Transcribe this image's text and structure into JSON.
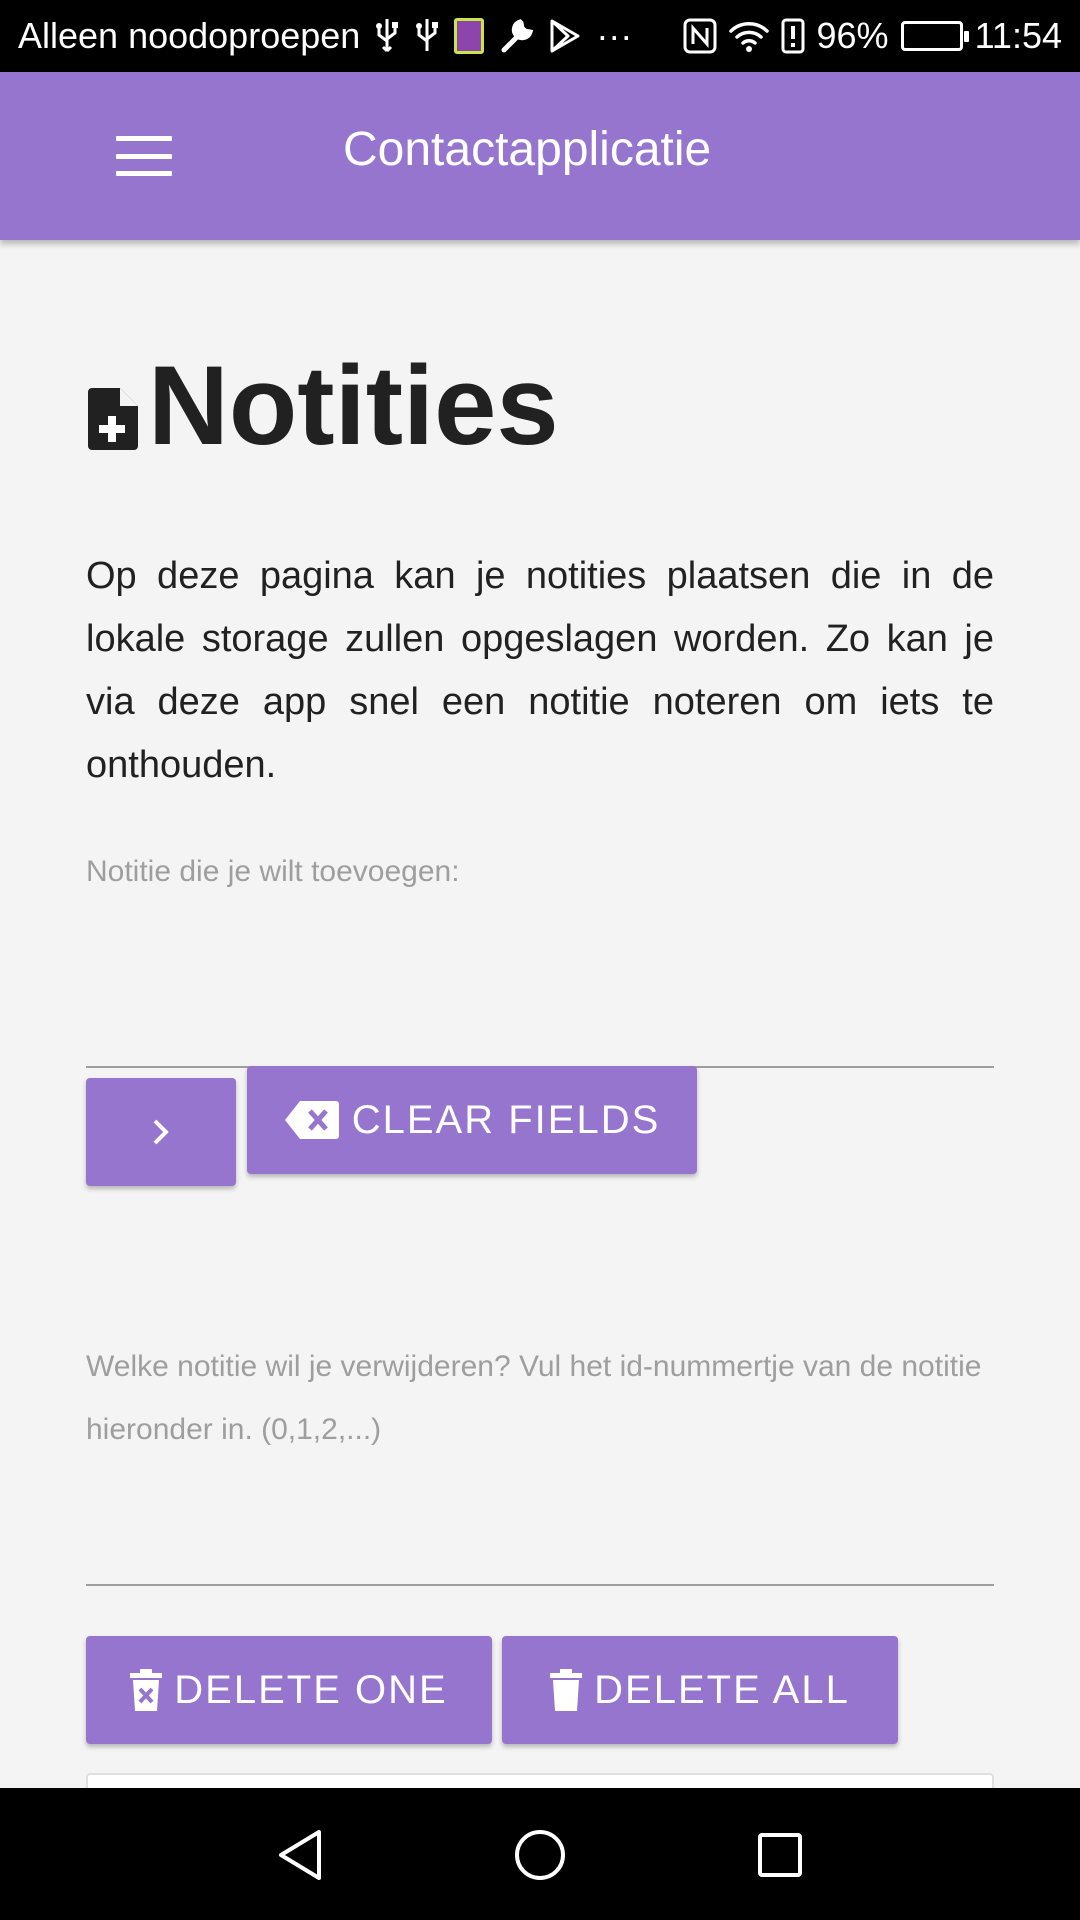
{
  "status_bar": {
    "carrier_text": "Alleen noodoproepen",
    "overflow": "···",
    "battery_percent": "96%",
    "time": "11:54",
    "icons": [
      "usb-icon",
      "usb-icon",
      "sim-card-icon",
      "wrench-icon",
      "play-store-icon",
      "nfc-icon",
      "wifi-icon",
      "alert-icon",
      "battery-icon"
    ]
  },
  "app_bar": {
    "title": "Contactapplicatie",
    "menu_icon": "menu-icon"
  },
  "page": {
    "title": "Notities",
    "title_icon": "note-add-icon",
    "intro": "Op deze pagina kan je notities plaatsen die in de lokale storage zullen opgeslagen worden. Zo kan je via deze app snel een notitie noteren om iets te onthouden."
  },
  "add_form": {
    "label": "Notitie die je wilt toevoegen:",
    "value": "",
    "submit_icon": "chevron-right-icon",
    "clear_label": "CLEAR FIELDS",
    "clear_icon": "backspace-icon"
  },
  "delete_form": {
    "label": "Welke notitie wil je verwijderen? Vul het id-nummertje van de notitie hieronder in. (0,1,2,...)",
    "value": "",
    "delete_one_label": "DELETE ONE",
    "delete_one_icon": "delete-x-icon",
    "delete_all_label": "DELETE ALL",
    "delete_all_icon": "trash-icon"
  },
  "colors": {
    "primary": "#9575cd",
    "background": "#f4f4f4",
    "text": "#212121",
    "muted": "#9e9e9e"
  },
  "nav_bar": {
    "buttons": [
      "back-icon",
      "home-icon",
      "recents-icon"
    ]
  }
}
